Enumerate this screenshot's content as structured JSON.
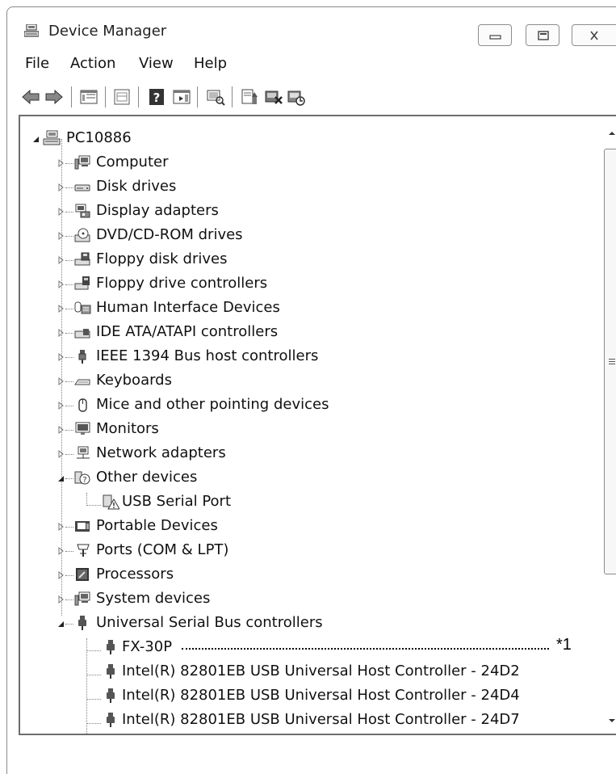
{
  "window": {
    "title": "Device Manager",
    "controls": {
      "minimize": "minimize",
      "maximize": "maximize",
      "close": "close"
    }
  },
  "menu": [
    "File",
    "Action",
    "View",
    "Help"
  ],
  "toolbar": {
    "buttons": [
      "back-icon",
      "forward-icon",
      "properties-icon",
      "refresh-icon",
      "help-icon",
      "view-icon",
      "scan-hardware-icon",
      "update-driver-icon",
      "uninstall-icon",
      "enable-device-icon"
    ]
  },
  "tree": {
    "root": "PC10886",
    "categories": [
      {
        "label": "Computer",
        "expanded": false,
        "icon": "computer-icon"
      },
      {
        "label": "Disk drives",
        "expanded": false,
        "icon": "disk-drive-icon"
      },
      {
        "label": "Display adapters",
        "expanded": false,
        "icon": "display-adapter-icon"
      },
      {
        "label": "DVD/CD-ROM drives",
        "expanded": false,
        "icon": "dvd-drive-icon"
      },
      {
        "label": "Floppy disk drives",
        "expanded": false,
        "icon": "floppy-drive-icon"
      },
      {
        "label": "Floppy drive controllers",
        "expanded": false,
        "icon": "floppy-controller-icon"
      },
      {
        "label": "Human Interface Devices",
        "expanded": false,
        "icon": "hid-icon"
      },
      {
        "label": "IDE ATA/ATAPI controllers",
        "expanded": false,
        "icon": "ide-controller-icon"
      },
      {
        "label": "IEEE 1394 Bus host controllers",
        "expanded": false,
        "icon": "ieee1394-icon"
      },
      {
        "label": "Keyboards",
        "expanded": false,
        "icon": "keyboard-icon"
      },
      {
        "label": "Mice and other pointing devices",
        "expanded": false,
        "icon": "mouse-icon"
      },
      {
        "label": "Monitors",
        "expanded": false,
        "icon": "monitor-icon"
      },
      {
        "label": "Network adapters",
        "expanded": false,
        "icon": "network-adapter-icon"
      },
      {
        "label": "Other devices",
        "expanded": true,
        "icon": "unknown-device-icon",
        "children": [
          {
            "label": "USB Serial Port",
            "icon": "warning-device-icon"
          }
        ]
      },
      {
        "label": "Portable Devices",
        "expanded": false,
        "icon": "portable-device-icon"
      },
      {
        "label": "Ports (COM & LPT)",
        "expanded": false,
        "icon": "port-icon"
      },
      {
        "label": "Processors",
        "expanded": false,
        "icon": "processor-icon"
      },
      {
        "label": "System devices",
        "expanded": false,
        "icon": "system-device-icon"
      },
      {
        "label": "Universal Serial Bus controllers",
        "expanded": true,
        "icon": "usb-icon",
        "children": [
          {
            "label": "FX-30P",
            "icon": "usb-device-icon",
            "callout": "*1"
          },
          {
            "label": "Intel(R) 82801EB USB Universal Host Controller - 24D2",
            "icon": "usb-device-icon"
          },
          {
            "label": "Intel(R) 82801EB USB Universal Host Controller - 24D4",
            "icon": "usb-device-icon"
          },
          {
            "label": "Intel(R) 82801EB USB Universal Host Controller - 24D7",
            "icon": "usb-device-icon"
          }
        ]
      }
    ]
  },
  "colors": {
    "frame": "#6d6d6d",
    "text": "#111111",
    "icon": "#3a3a3a"
  }
}
